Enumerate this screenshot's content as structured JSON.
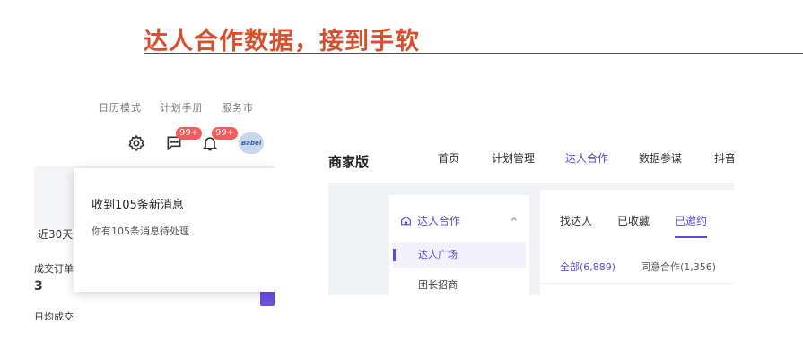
{
  "slide": {
    "title": "达人合作数据，接到手软"
  },
  "left_shot": {
    "cut_menu": [
      "日历模式",
      "计划手册",
      "服务市"
    ],
    "icons": [
      "gear-icon",
      "chat-icon",
      "bell-icon"
    ],
    "badges": [
      "99+",
      "99+"
    ],
    "avatar_text": "Babel",
    "popup": {
      "title": "收到105条新消息",
      "subtitle": "你有105条消息待处理"
    },
    "labels": {
      "range": "近30天",
      "order_metric": "成交订单数",
      "order_value": "3",
      "bottom_metric": "日均成交"
    },
    "accent": "#6b4fe0"
  },
  "right_shot": {
    "brand": "商家版",
    "nav": [
      "首页",
      "计划管理",
      "达人合作",
      "数据参谋",
      "抖音"
    ],
    "nav_active": "达人合作",
    "sidebar": {
      "heading": "达人合作",
      "items": [
        "达人广场",
        "团长招商"
      ]
    },
    "tabs": [
      "找达人",
      "已收藏",
      "已邀约"
    ],
    "filters": [
      "全部(6,889)",
      "同意合作(1,356)"
    ],
    "accent": "#5b4ad8"
  }
}
